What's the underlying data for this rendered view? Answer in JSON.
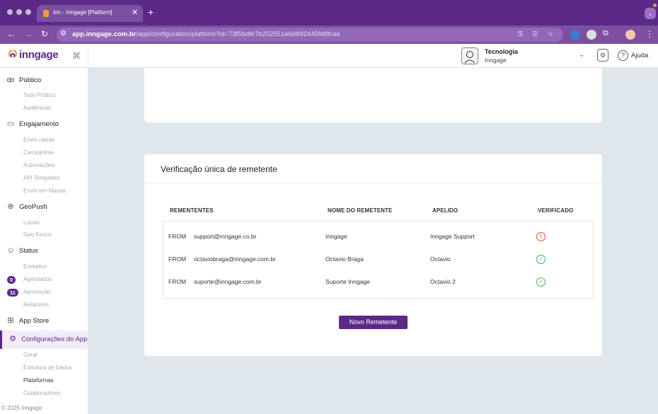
{
  "browser": {
    "tab_title": "Inn - Inngage [Platform]",
    "url_domain": "app.inngage.com.br",
    "url_path": "/app/configuration/platform?id=73f5bdfe7b252551e6d892445fd8fcae"
  },
  "header": {
    "logo": "inngage",
    "org_name": "Tecnologia",
    "org_sub": "Inngage",
    "help_label": "Ajuda"
  },
  "sidebar": {
    "sections": [
      {
        "icon": "people-icon",
        "label": "Público",
        "items": [
          "Todo Público",
          "Audiências"
        ]
      },
      {
        "icon": "engagement-icon",
        "label": "Engajamento",
        "items": [
          "Envio rápido",
          "Campanhas",
          "Automações",
          "API Templates",
          "Envio em Massa"
        ]
      },
      {
        "icon": "geopush-icon",
        "label": "GeoPush",
        "items": [
          "Locais",
          "Geo Fence"
        ]
      },
      {
        "icon": "status-icon",
        "label": "Status",
        "items": [
          "Enviados",
          "Agendados",
          "Aprovação",
          "Relatórios"
        ]
      },
      {
        "icon": "app-store-icon",
        "label": "App Store",
        "items": []
      },
      {
        "icon": "settings-icon",
        "label": "Configurações do App",
        "items": [
          "Geral",
          "Estrutura de Dados",
          "Plataformas",
          "Colaboradores"
        ]
      }
    ],
    "badges": {
      "agendados": "0",
      "aprovacao": "11"
    },
    "active_item": "Plataformas",
    "footer": "© 2025 Inngage"
  },
  "verification": {
    "title": "Verificação única de remetente",
    "columns": [
      "REMENTENTES",
      "NOME DO REMETENTE",
      "APELIDO",
      "VERIFICADO"
    ],
    "rows": [
      {
        "prefix": "FROM",
        "email": "support@inngage.co.br",
        "name": "Inngage",
        "nickname": "Inngage Support",
        "verified": false
      },
      {
        "prefix": "FROM",
        "email": "octaviobraga@inngage.com.br",
        "name": "Octavio Braga",
        "nickname": "Octavio",
        "verified": true
      },
      {
        "prefix": "FROM",
        "email": "suporte@inngage.com.br",
        "name": "Suporte Inngage",
        "nickname": "Octavio 2",
        "verified": true
      }
    ],
    "new_button": "Novo Remetente"
  },
  "colors": {
    "brand": "#5b2a86",
    "warn": "#e0453a",
    "ok": "#4caf50"
  }
}
